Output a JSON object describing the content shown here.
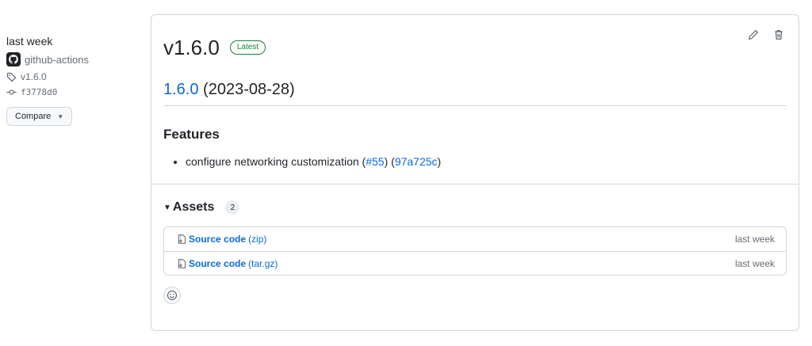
{
  "meta": {
    "date_text": "last week",
    "author": "github-actions",
    "tag": "v1.6.0",
    "commit": "f3778d0",
    "compare_label": "Compare"
  },
  "release": {
    "title": "v1.6.0",
    "badge": "Latest",
    "version_link": "1.6.0",
    "version_date": "(2023-08-28)",
    "features_heading": "Features",
    "features": [
      {
        "text": "configure networking customization (",
        "issue": "#55",
        "mid": ") (",
        "commit": "97a725c",
        "end": ")"
      }
    ]
  },
  "assets": {
    "title": "Assets",
    "count": "2",
    "items": [
      {
        "name": "Source code",
        "format": "(zip)",
        "time": "last week"
      },
      {
        "name": "Source code",
        "format": "(tar.gz)",
        "time": "last week"
      }
    ]
  },
  "icons": {
    "edit": "pencil-icon",
    "delete": "trash-icon",
    "tag": "tag-icon",
    "commit": "git-commit-icon",
    "file": "file-zip-icon",
    "reaction": "smiley-icon"
  },
  "colors": {
    "link": "#0969da",
    "latest_green": "#1a7f37",
    "border": "#d0d7de"
  }
}
